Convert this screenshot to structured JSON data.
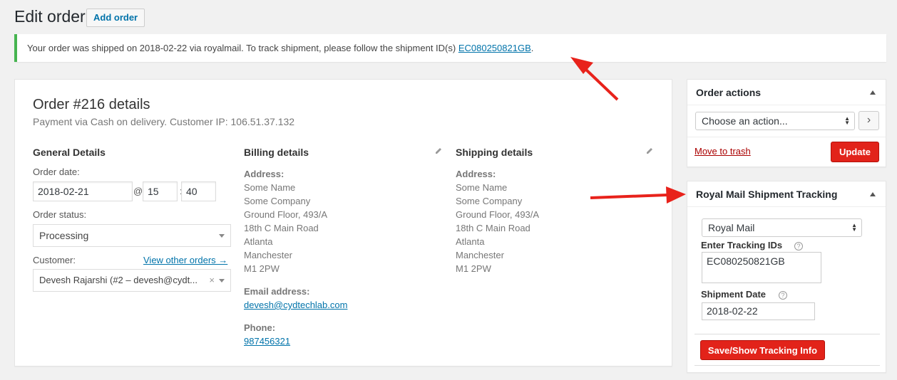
{
  "header": {
    "title": "Edit order",
    "add_button": "Add order"
  },
  "notice": {
    "text": "Your order was shipped on 2018-02-22 via royalmail. To track shipment, please follow the shipment ID(s)",
    "tracking_link": "EC080250821GB",
    "suffix": "."
  },
  "order": {
    "title": "Order #216 details",
    "meta": "Payment via Cash on delivery. Customer IP: 106.51.37.132",
    "general": {
      "heading": "General Details",
      "date_label": "Order date:",
      "date": "2018-02-21",
      "at": "@",
      "hour": "15",
      "colon": ":",
      "minute": "40",
      "status_label": "Order status:",
      "status": "Processing",
      "customer_label": "Customer:",
      "view_orders": "View other orders →",
      "customer": "Devesh Rajarshi (#2 – devesh@cydt...",
      "clear": "×"
    },
    "billing": {
      "heading": "Billing details",
      "address_label": "Address:",
      "address": [
        "Some Name",
        "Some Company",
        "Ground Floor, 493/A",
        "18th C Main Road",
        "Atlanta",
        "Manchester",
        "M1 2PW"
      ],
      "email_label": "Email address:",
      "email": "devesh@cydtechlab.com",
      "phone_label": "Phone:",
      "phone": "987456321"
    },
    "shipping": {
      "heading": "Shipping details",
      "address_label": "Address:",
      "address": [
        "Some Name",
        "Some Company",
        "Ground Floor, 493/A",
        "18th C Main Road",
        "Atlanta",
        "Manchester",
        "M1 2PW"
      ]
    }
  },
  "order_actions": {
    "title": "Order actions",
    "select": "Choose an action...",
    "go": "›",
    "trash": "Move to trash",
    "update": "Update"
  },
  "tracking": {
    "title": "Royal Mail Shipment Tracking",
    "carrier": "Royal Mail",
    "ids_label": "Enter Tracking IDs",
    "ids_value": "EC080250821GB",
    "date_label": "Shipment Date",
    "date_value": "2018-02-22",
    "help": "?",
    "save": "Save/Show Tracking Info"
  },
  "colors": {
    "accent_red": "#e2231a",
    "link": "#0073aa",
    "notice_border": "#46b450",
    "arrow": "#e8221b"
  }
}
